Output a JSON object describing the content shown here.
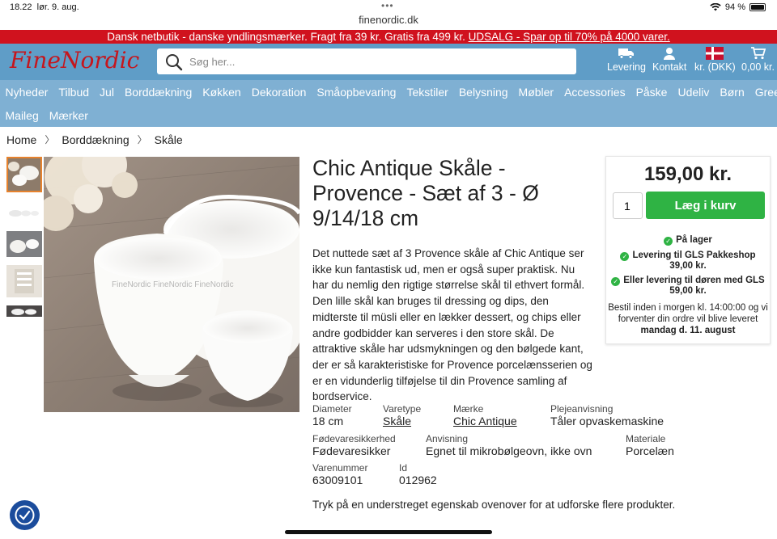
{
  "status": {
    "time": "18.22",
    "date": "lør. 9. aug.",
    "battery": "94 %",
    "url": "finenordic.dk"
  },
  "promo": {
    "text": "Dansk netbutik - danske yndlingsmærker. Fragt fra 39 kr. Gratis fra 499 kr. ",
    "link": "UDSALG - Spar op til 70% på 4000 varer."
  },
  "header": {
    "logo": "FineNordic",
    "search_placeholder": "Søg her...",
    "delivery": "Levering",
    "contact": "Kontakt",
    "currency": "kr. (DKK)",
    "cart": "0,00 kr."
  },
  "nav": {
    "row1": [
      "Nyheder",
      "Tilbud",
      "Jul",
      "Borddækning",
      "Køkken",
      "Dekoration",
      "Småopbevaring",
      "Tekstiler",
      "Belysning",
      "Møbler",
      "Accessories",
      "Påske",
      "Udeliv",
      "Børn",
      "GreenGate"
    ],
    "row2": [
      "Maileg",
      "Mærker"
    ]
  },
  "breadcrumb": [
    "Home",
    "Borddækning",
    "Skåle"
  ],
  "product": {
    "title": "Chic Antique Skåle - Provence - Sæt af 3 - Ø 9/14/18 cm",
    "description": "Det nuttede sæt af 3 Provence skåle af Chic Antique ser ikke kun fantastisk ud, men er også super praktisk. Nu har du nemlig den rigtige størrelse skål til ethvert formål. Den lille skål kan bruges til dressing og dips, den midterste til müsli eller en lækker dessert, og chips eller andre godbidder kan serveres i den store skål. De attraktive skåle har udsmykningen og den bølgede kant, der er så karakteristiske for Provence porcelænsserien og er en vidunderlig tilføjelse til din Provence samling af bordservice.",
    "watermark": "FineNordic  FineNordic  FineNordic"
  },
  "buybox": {
    "price": "159,00 kr.",
    "qty": "1",
    "add_to_cart": "Læg i kurv",
    "in_stock": "På lager",
    "gls_pakkeshop": "Levering til GLS Pakkeshop",
    "gls_pakkeshop_price": "39,00 kr.",
    "gls_door": "Eller levering til døren med GLS",
    "gls_door_price": "59,00 kr.",
    "order_note": "Bestil inden i morgen kl. 14:00:00 og vi forventer din ordre vil blive leveret",
    "delivery_date": "mandag d. 11. august"
  },
  "attributes": [
    {
      "key": "Diameter",
      "value": "18 cm",
      "link": false
    },
    {
      "key": "Varetype",
      "value": "Skåle",
      "link": true
    },
    {
      "key": "Mærke",
      "value": "Chic Antique",
      "link": true
    },
    {
      "key": "Plejeanvisning",
      "value": "Tåler opvaskemaskine",
      "link": false
    },
    {
      "key": "Fødevaresikkerhed",
      "value": "Fødevaresikker",
      "link": false
    },
    {
      "key": "Anvisning",
      "value": "Egnet til mikrobølgeovn, ikke ovn",
      "link": false
    },
    {
      "key": "Materiale",
      "value": "Porcelæn",
      "link": false
    },
    {
      "key": "Varenummer",
      "value": "63009101",
      "link": false
    },
    {
      "key": "Id",
      "value": "012962",
      "link": false
    }
  ],
  "footnote": "Tryk på en understreget egenskab ovenover for at udforske flere produkter.",
  "colors": {
    "promo": "#d0121e",
    "header": "#5f9dc7",
    "nav": "#7fb0d3",
    "cta": "#2fb344",
    "logo": "#c5161d"
  }
}
